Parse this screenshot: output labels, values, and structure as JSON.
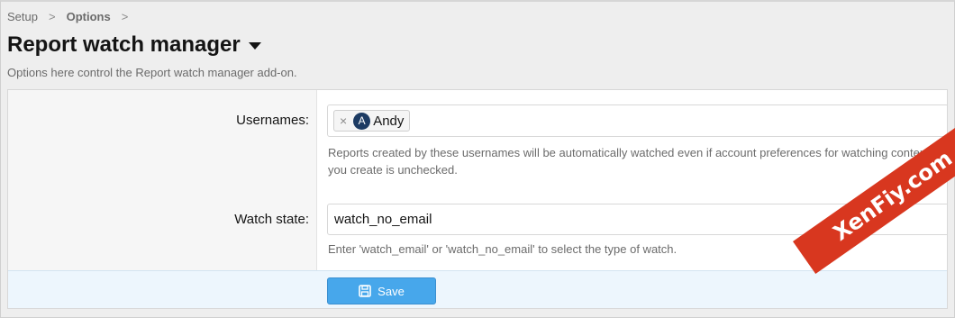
{
  "breadcrumb": {
    "items": [
      "Setup",
      "Options"
    ],
    "separator": ">"
  },
  "page": {
    "title": "Report watch manager",
    "description": "Options here control the Report watch manager add-on."
  },
  "options": {
    "usernames": {
      "label": "Usernames:",
      "tokens": [
        {
          "avatar_letter": "A",
          "name": "Andy",
          "remove_glyph": "×"
        }
      ],
      "explain": "Reports created by these usernames will be automatically watched even if account preferences for watching content you create is unchecked."
    },
    "watch_state": {
      "label": "Watch state:",
      "value": "watch_no_email",
      "explain": "Enter 'watch_email' or 'watch_no_email' to select the type of watch."
    }
  },
  "footer": {
    "save_label": "Save",
    "save_icon": "save-icon"
  },
  "watermark": {
    "text": "XenFiy.com"
  },
  "colors": {
    "accent": "#47a7eb",
    "watermark": "#d8371f",
    "avatar": "#1d3b63"
  }
}
